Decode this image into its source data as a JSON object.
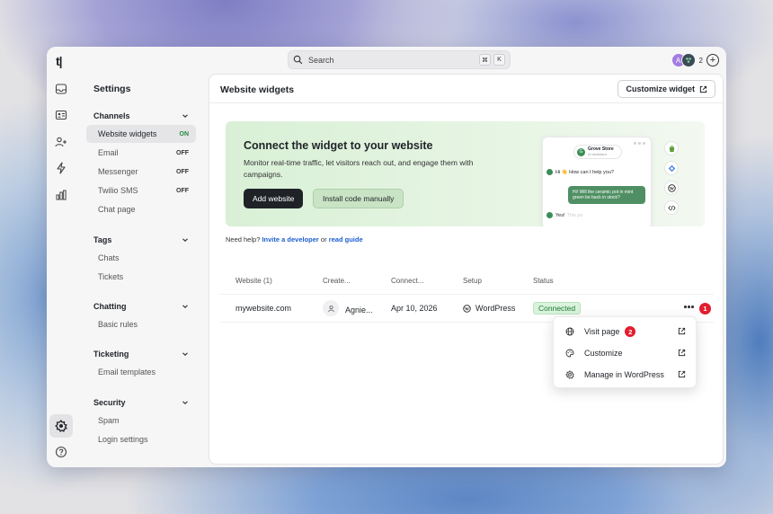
{
  "app": {
    "logo": "t|"
  },
  "search": {
    "placeholder": "Search",
    "shortcut_cmd": "⌘",
    "shortcut_key": "K"
  },
  "header": {
    "avatar_letter": "A",
    "avatar_count": "2",
    "add": "+"
  },
  "rail": {
    "avatar_letter": "A"
  },
  "sidebar": {
    "title": "Settings",
    "sections": [
      {
        "title": "Channels",
        "items": [
          {
            "label": "Website widgets",
            "badge": "ON"
          },
          {
            "label": "Email",
            "badge": "OFF"
          },
          {
            "label": "Messenger",
            "badge": "OFF"
          },
          {
            "label": "Twilio SMS",
            "badge": "OFF"
          },
          {
            "label": "Chat page",
            "badge": ""
          }
        ]
      },
      {
        "title": "Tags",
        "items": [
          {
            "label": "Chats"
          },
          {
            "label": "Tickets"
          }
        ]
      },
      {
        "title": "Chatting",
        "items": [
          {
            "label": "Basic rules"
          }
        ]
      },
      {
        "title": "Ticketing",
        "items": [
          {
            "label": "Email templates"
          }
        ]
      },
      {
        "title": "Security",
        "items": [
          {
            "label": "Spam"
          },
          {
            "label": "Login settings"
          }
        ]
      }
    ]
  },
  "main": {
    "title": "Website widgets",
    "customize_button": "Customize widget",
    "banner": {
      "title": "Connect the widget to your website",
      "description": "Monitor real-time traffic, let visitors reach out, and engage them with campaigns.",
      "primary_button": "Add website",
      "secondary_button": "Install code manually",
      "preview": {
        "store_name": "Grove Store",
        "store_sub": "AI assistant",
        "store_initial": "G",
        "msg1": "Hi 👋 How can I help you?",
        "msg2": "Hi! Will the ceramic pot in mint green be back in stock?",
        "msg3": "Yes!",
        "msg3_fade": "This po"
      }
    },
    "help": {
      "prefix": "Need help?",
      "link1": "Invite a developer",
      "or": "or",
      "link2": "read guide"
    },
    "table": {
      "headers": [
        "Website (1)",
        "Create...",
        "Connect...",
        "Setup",
        "Status"
      ],
      "row": {
        "website": "mywebsite.com",
        "created_by": "Agnie...",
        "connected": "Apr 10, 2026",
        "setup": "WordPress",
        "status": "Connected"
      }
    },
    "badges": {
      "more": "1",
      "visit": "2"
    },
    "menu": {
      "items": [
        {
          "label": "Visit page"
        },
        {
          "label": "Customize"
        },
        {
          "label": "Manage in WordPress"
        }
      ]
    }
  },
  "colors": {
    "accent": "#1f2328",
    "success": "#217a35",
    "link": "#1d5fd1",
    "badge_red": "#e11d2e"
  }
}
